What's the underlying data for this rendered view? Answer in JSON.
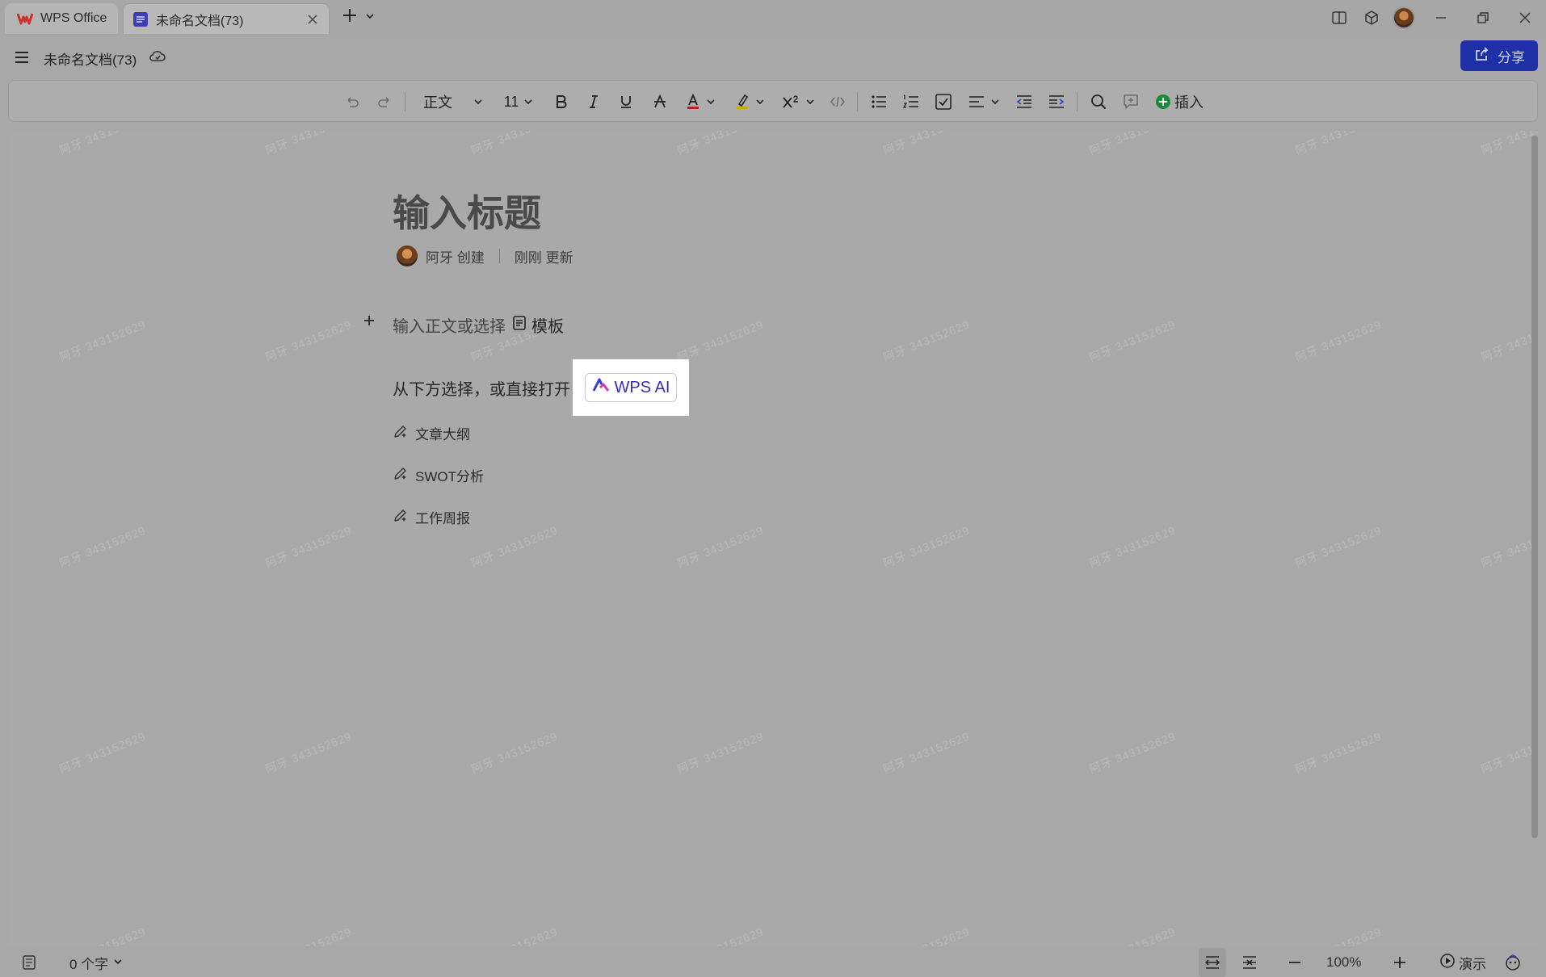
{
  "tabs": {
    "app_label": "WPS Office",
    "doc_label": "未命名文档(73)"
  },
  "menubar": {
    "doc_name": "未命名文档(73)",
    "share_label": "分享"
  },
  "toolbar": {
    "style_label": "正文",
    "font_size": "11",
    "insert_label": "插入"
  },
  "document": {
    "title_placeholder": "输入标题",
    "author": "阿牙 创建",
    "updated": "刚刚 更新",
    "body_placeholder": "输入正文或选择",
    "template_label": "模板",
    "choose_text": "从下方选择，或直接打开",
    "ai_button": "WPS AI",
    "suggestions": [
      "文章大纲",
      "SWOT分析",
      "工作周报"
    ]
  },
  "watermark": "阿牙 343152629",
  "statusbar": {
    "word_count": "0 个字",
    "zoom": "100%",
    "present_label": "演示"
  },
  "colors": {
    "brand_red": "#c9332b",
    "share_blue": "#1e2fa8",
    "ai_purple": "#3f2bb8",
    "insert_green": "#1b8a3a"
  }
}
